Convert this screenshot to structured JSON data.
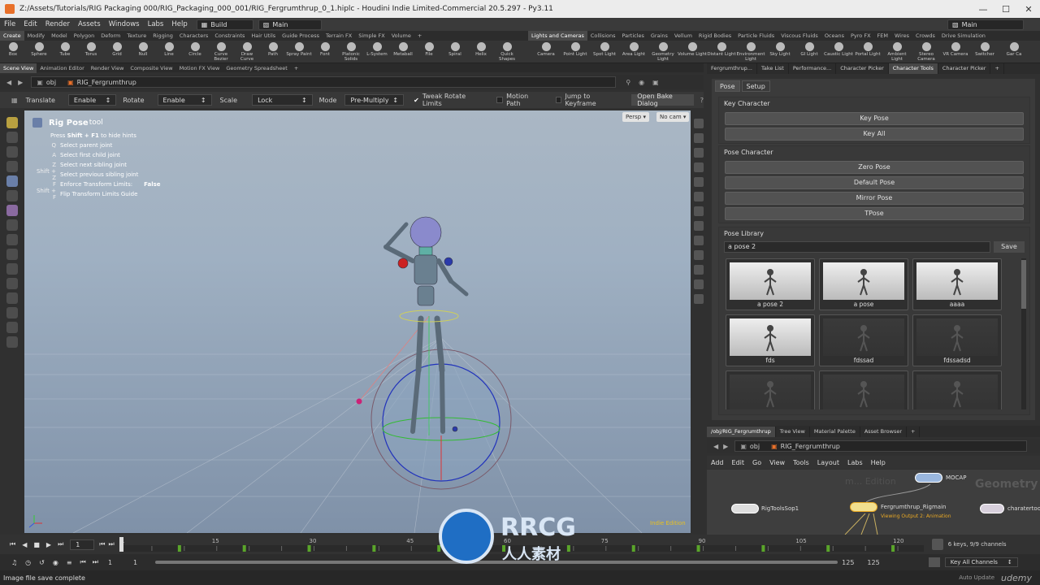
{
  "window": {
    "title": "Z:/Assets/Tutorials/RIG Packaging 000/RIG_Packaging_000_001/RIG_Fergrumthrup_0_1.hiplc - Houdini Indie Limited-Commercial 20.5.297 - Py3.11"
  },
  "menubar": {
    "items": [
      "File",
      "Edit",
      "Render",
      "Assets",
      "Windows",
      "Labs",
      "Help"
    ],
    "desktop": "Build",
    "context": "Main",
    "right_context": "Main"
  },
  "shelf_tabs_left": [
    "Create",
    "Modify",
    "Model",
    "Polygon",
    "Deform",
    "Texture",
    "Rigging",
    "Characters",
    "Constraints",
    "Hair Utils",
    "Guide Process",
    "Terrain FX",
    "Simple FX",
    "Volume"
  ],
  "shelf_tabs_right": [
    "Lights and Cameras",
    "Collisions",
    "Particles",
    "Grains",
    "Vellum",
    "Rigid Bodies",
    "Particle Fluids",
    "Viscous Fluids",
    "Oceans",
    "Pyro FX",
    "FEM",
    "Wires",
    "Crowds",
    "Drive Simulation"
  ],
  "shelf_tools_left": [
    "Box",
    "Sphere",
    "Tube",
    "Torus",
    "Grid",
    "Null",
    "Line",
    "Circle",
    "Curve Bezier",
    "Draw Curve",
    "Path",
    "Spray Paint",
    "Font",
    "Platonic Solids",
    "L-System",
    "Metaball",
    "File",
    "Spiral",
    "Helix",
    "Quick Shapes"
  ],
  "shelf_tools_right": [
    "Camera",
    "Point Light",
    "Spot Light",
    "Area Light",
    "Geometry Light",
    "Volume Light",
    "Distant Light",
    "Environment Light",
    "Sky Light",
    "GI Light",
    "Caustic Light",
    "Portal Light",
    "Ambient Light",
    "Stereo Camera",
    "VR Camera",
    "Switcher",
    "Gar Ca"
  ],
  "pane_tabs": [
    "Scene View",
    "Animation Editor",
    "Render View",
    "Composite View",
    "Motion FX View",
    "Geometry Spreadsheet"
  ],
  "path": {
    "root": "obj",
    "node": "RIG_Fergrumthrup"
  },
  "vp_toolbar": {
    "translate_label": "Translate",
    "translate_value": "Enable",
    "rotate_label": "Rotate",
    "rotate_value": "Enable",
    "scale_label": "Scale",
    "scale_value": "Lock",
    "mode_label": "Mode",
    "mode_value": "Pre-Multiply",
    "tweak_label": "Tweak Rotate Limits",
    "motion_path_label": "Motion Path",
    "jump_label": "Jump to Keyframe",
    "bake_label": "Open Bake Dialog"
  },
  "hud": {
    "tool_bold": "Rig Pose",
    "tool_suffix": " tool",
    "hint_pre": "Press ",
    "hint_key": "Shift + F1",
    "hint_post": " to hide hints",
    "hints": [
      {
        "key": "Q",
        "text": "Select parent joint",
        "value": ""
      },
      {
        "key": "A",
        "text": "Select first child joint",
        "value": ""
      },
      {
        "key": "Z",
        "text": "Select next sibling joint",
        "value": ""
      },
      {
        "key": "Shift + Z",
        "text": "Select previous sibling joint",
        "value": ""
      },
      {
        "key": "F",
        "text": "Enforce Transform Limits:",
        "value": "False"
      },
      {
        "key": "Shift + F",
        "text": "Flip Transform Limits Guide",
        "value": ""
      }
    ]
  },
  "viewport": {
    "persp": "Persp",
    "cam": "No cam",
    "watermark": "Indie Edition"
  },
  "right_tabs": [
    "Fergrumthrup...",
    "Take List",
    "Performance...",
    "Character Picker",
    "Character Tools",
    "Character Picker"
  ],
  "char_tools": {
    "tabs": [
      "Pose",
      "Setup"
    ],
    "key_char_title": "Key Character",
    "key_buttons": [
      "Key Pose",
      "Key All"
    ],
    "pose_char_title": "Pose Character",
    "pose_buttons": [
      "Zero Pose",
      "Default Pose",
      "Mirror Pose",
      "TPose"
    ],
    "library_title": "Pose Library",
    "name_input": "a pose 2",
    "save_label": "Save",
    "thumbs": [
      "a pose 2",
      "a pose",
      "aaaa",
      "fds",
      "fdssad",
      "fdssadsd",
      "",
      "",
      ""
    ]
  },
  "ne_tabs": [
    "/obj/RIG_Fergrumthrup",
    "Tree View",
    "Material Palette",
    "Asset Browser"
  ],
  "ne_path": {
    "root": "obj",
    "node": "RIG_Fergrumthrup"
  },
  "ne_menu": [
    "Add",
    "Edit",
    "Go",
    "View",
    "Tools",
    "Layout",
    "Labs",
    "Help"
  ],
  "network": {
    "nodes": [
      "MOCAP",
      "RigToolsSop1",
      "Fergrumthrup_Rigmain",
      "charatertoo"
    ],
    "note": "Viewing Output 2: Animation",
    "bg_word": "Geometry",
    "bg_word2": "m... Edition"
  },
  "timeline": {
    "frame": "1",
    "ticks": [
      "1",
      "15",
      "30",
      "45",
      "60",
      "75",
      "90",
      "105",
      "120"
    ],
    "start": "1",
    "start2": "1",
    "end": "125",
    "end2": "125",
    "keys_info": "6 keys, 9/9 channels",
    "key_channels": "Key All Channels"
  },
  "status": {
    "message": "Image file save complete",
    "auto_update": "Auto Update",
    "brand": "udemy"
  },
  "overlay": {
    "logo": "RRCG",
    "sub": "人人素材"
  },
  "colors": {
    "accent": "#e8a825",
    "bg": "#303030",
    "panel": "#3b3b3b",
    "key": "#5aa52a"
  }
}
